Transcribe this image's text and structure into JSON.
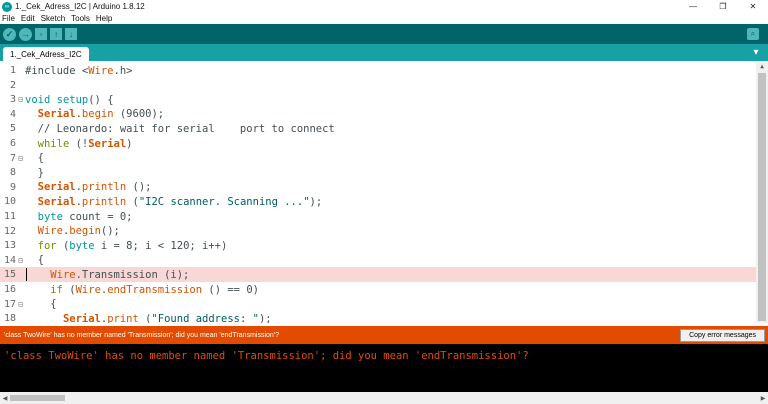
{
  "window": {
    "title": "1._Cek_Adress_I2C | Arduino 1.8.12",
    "icon": "arduino-logo",
    "minimize": "—",
    "maximize": "❐",
    "close": "✕"
  },
  "menu": [
    "File",
    "Edit",
    "Sketch",
    "Tools",
    "Help"
  ],
  "toolbar": {
    "verify_icon": "✓",
    "upload_icon": "→",
    "new_icon": "▫",
    "open_icon": "↑",
    "save_icon": "↓",
    "serial_monitor_icon": "⌕"
  },
  "tabs": {
    "active": "1._Cek_Adress_I2C",
    "menu_icon": "▾"
  },
  "editor": {
    "lines": [
      {
        "n": "1",
        "fold": "",
        "segments": [
          {
            "t": "#include <",
            "c": ""
          },
          {
            "t": "Wire",
            "c": "kw-orange"
          },
          {
            "t": ".h>",
            "c": ""
          }
        ]
      },
      {
        "n": "2",
        "fold": "",
        "segments": []
      },
      {
        "n": "3",
        "fold": "⊟",
        "segments": [
          {
            "t": "void",
            "c": "kw-blue"
          },
          {
            "t": " ",
            "c": ""
          },
          {
            "t": "setup",
            "c": "kw-blue"
          },
          {
            "t": "() {",
            "c": ""
          }
        ]
      },
      {
        "n": "4",
        "fold": "",
        "segments": [
          {
            "t": "  ",
            "c": ""
          },
          {
            "t": "Serial",
            "c": "kw-bold"
          },
          {
            "t": ".",
            "c": ""
          },
          {
            "t": "begin",
            "c": "kw-orange"
          },
          {
            "t": " (9600);",
            "c": ""
          }
        ]
      },
      {
        "n": "5",
        "fold": "",
        "segments": [
          {
            "t": "  // Leonardo: wait for serial    port to connect",
            "c": "cmt"
          }
        ]
      },
      {
        "n": "6",
        "fold": "",
        "segments": [
          {
            "t": "  ",
            "c": ""
          },
          {
            "t": "while",
            "c": "kw-green"
          },
          {
            "t": " (!",
            "c": ""
          },
          {
            "t": "Serial",
            "c": "kw-bold"
          },
          {
            "t": ")",
            "c": ""
          }
        ]
      },
      {
        "n": "7",
        "fold": "⊟",
        "segments": [
          {
            "t": "  {",
            "c": ""
          }
        ]
      },
      {
        "n": "8",
        "fold": "",
        "segments": [
          {
            "t": "  }",
            "c": ""
          }
        ]
      },
      {
        "n": "9",
        "fold": "",
        "segments": [
          {
            "t": "  ",
            "c": ""
          },
          {
            "t": "Serial",
            "c": "kw-bold"
          },
          {
            "t": ".",
            "c": ""
          },
          {
            "t": "println",
            "c": "kw-orange"
          },
          {
            "t": " ();",
            "c": ""
          }
        ]
      },
      {
        "n": "10",
        "fold": "",
        "segments": [
          {
            "t": "  ",
            "c": ""
          },
          {
            "t": "Serial",
            "c": "kw-bold"
          },
          {
            "t": ".",
            "c": ""
          },
          {
            "t": "println",
            "c": "kw-orange"
          },
          {
            "t": " (",
            "c": ""
          },
          {
            "t": "\"I2C scanner. Scanning ...\"",
            "c": "str"
          },
          {
            "t": ");",
            "c": ""
          }
        ]
      },
      {
        "n": "11",
        "fold": "",
        "segments": [
          {
            "t": "  ",
            "c": ""
          },
          {
            "t": "byte",
            "c": "kw-blue"
          },
          {
            "t": " count = 0;",
            "c": ""
          }
        ]
      },
      {
        "n": "12",
        "fold": "",
        "segments": [
          {
            "t": "  ",
            "c": ""
          },
          {
            "t": "Wire",
            "c": "kw-orange"
          },
          {
            "t": ".",
            "c": ""
          },
          {
            "t": "begin",
            "c": "kw-orange"
          },
          {
            "t": "();",
            "c": ""
          }
        ]
      },
      {
        "n": "13",
        "fold": "",
        "segments": [
          {
            "t": "  ",
            "c": ""
          },
          {
            "t": "for",
            "c": "kw-green"
          },
          {
            "t": " (",
            "c": ""
          },
          {
            "t": "byte",
            "c": "kw-blue"
          },
          {
            "t": " i = 8; i < 120; i++)",
            "c": ""
          }
        ]
      },
      {
        "n": "14",
        "fold": "⊟",
        "segments": [
          {
            "t": "  {",
            "c": ""
          }
        ]
      },
      {
        "n": "15",
        "fold": "",
        "hl": true,
        "segments": [
          {
            "t": "    ",
            "c": ""
          },
          {
            "t": "Wire",
            "c": "kw-orange"
          },
          {
            "t": ".Transmission (i);",
            "c": ""
          }
        ]
      },
      {
        "n": "16",
        "fold": "",
        "segments": [
          {
            "t": "    ",
            "c": ""
          },
          {
            "t": "if",
            "c": "kw-green"
          },
          {
            "t": " (",
            "c": ""
          },
          {
            "t": "Wire",
            "c": "kw-orange"
          },
          {
            "t": ".",
            "c": ""
          },
          {
            "t": "endTransmission",
            "c": "kw-orange"
          },
          {
            "t": " () == 0)",
            "c": ""
          }
        ]
      },
      {
        "n": "17",
        "fold": "⊟",
        "segments": [
          {
            "t": "    {",
            "c": ""
          }
        ]
      },
      {
        "n": "18",
        "fold": "",
        "segments": [
          {
            "t": "      ",
            "c": ""
          },
          {
            "t": "Serial",
            "c": "kw-bold"
          },
          {
            "t": ".",
            "c": ""
          },
          {
            "t": "print",
            "c": "kw-orange"
          },
          {
            "t": " (",
            "c": ""
          },
          {
            "t": "\"Found address: \"",
            "c": "str"
          },
          {
            "t": ");",
            "c": ""
          }
        ]
      }
    ]
  },
  "status": {
    "message": "'class TwoWire' has no member named 'Transmission'; did you mean 'endTransmission'?",
    "copy_button": "Copy error messages"
  },
  "console": {
    "text": "'class TwoWire' has no member named 'Transmission'; did you mean 'endTransmission'?"
  },
  "colors": {
    "toolbar": "#006468",
    "tabstrip": "#17a1a5",
    "error_bar": "#e34c00",
    "highlight_line": "#f8d7d5"
  }
}
